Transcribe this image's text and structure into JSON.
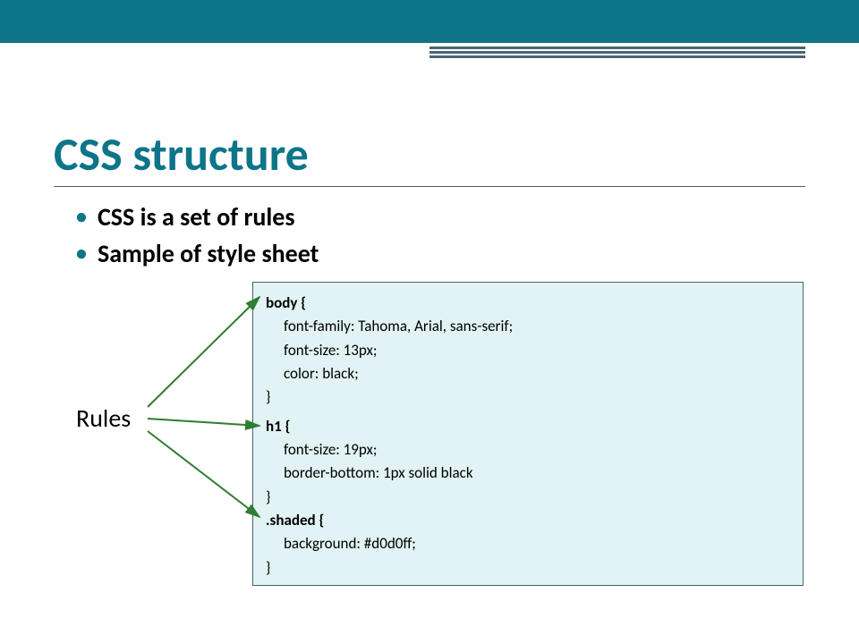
{
  "title": "CSS structure",
  "bullets": [
    "CSS is a set of rules",
    "Sample of style sheet"
  ],
  "rules_label": "Rules",
  "code": {
    "rule1": {
      "selector": "body {",
      "props": [
        "font-family: Tahoma, Arial, sans-serif;",
        "font-size: 13px;",
        "color: black;"
      ],
      "close": "}"
    },
    "rule2": {
      "selector": "h1 {",
      "props": [
        "font-size: 19px;",
        "border-bottom: 1px solid black"
      ],
      "close": "}"
    },
    "rule3": {
      "selector": ".shaded {",
      "props": [
        "background: #d0d0ff;"
      ],
      "close": "}"
    }
  },
  "colors": {
    "accent": "#0e7589",
    "arrow": "#2e7d32"
  }
}
